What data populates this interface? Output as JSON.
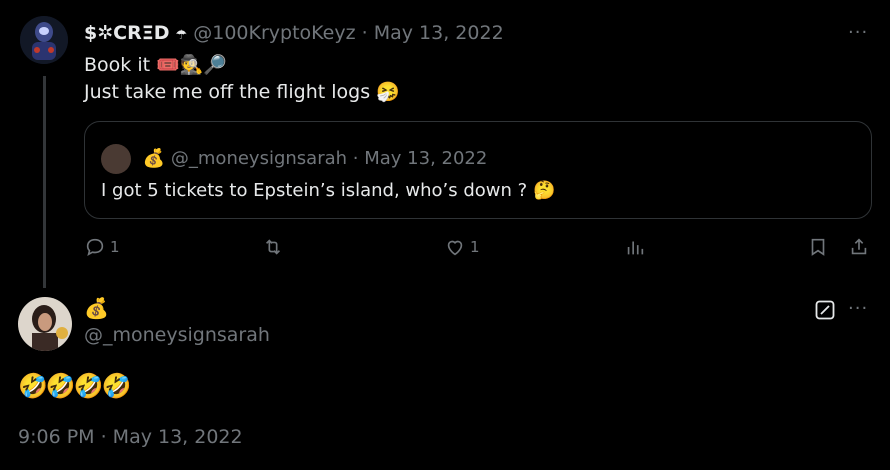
{
  "tweet1": {
    "display_name": "$✲CRΞD",
    "name_badge": "☂",
    "handle": "@100KryptoKeyz",
    "separator": "·",
    "date": "May 13, 2022",
    "line1": "Book it 🎟️🕵️🔎",
    "line2": "Just take me off the flight logs 🤧",
    "more_label": "···"
  },
  "quote": {
    "display_name_emoji": "💰",
    "handle": "@_moneysignsarah",
    "separator": "·",
    "date": "May 13, 2022",
    "text": "I got 5 tickets to Epstein’s island, who’s down ? 🤔"
  },
  "actions": {
    "reply_count": "1",
    "retweet_count": "",
    "like_count": "1",
    "views_count": ""
  },
  "tweet2": {
    "display_name_emoji": "💰",
    "handle": "@_moneysignsarah",
    "text": "🤣🤣🤣🤣",
    "timestamp": "9:06 PM · May 13, 2022",
    "more_label": "···"
  },
  "colors": {
    "background": "#000000",
    "text": "#e7e9ea",
    "muted": "#71767b",
    "border": "#2f3336"
  }
}
